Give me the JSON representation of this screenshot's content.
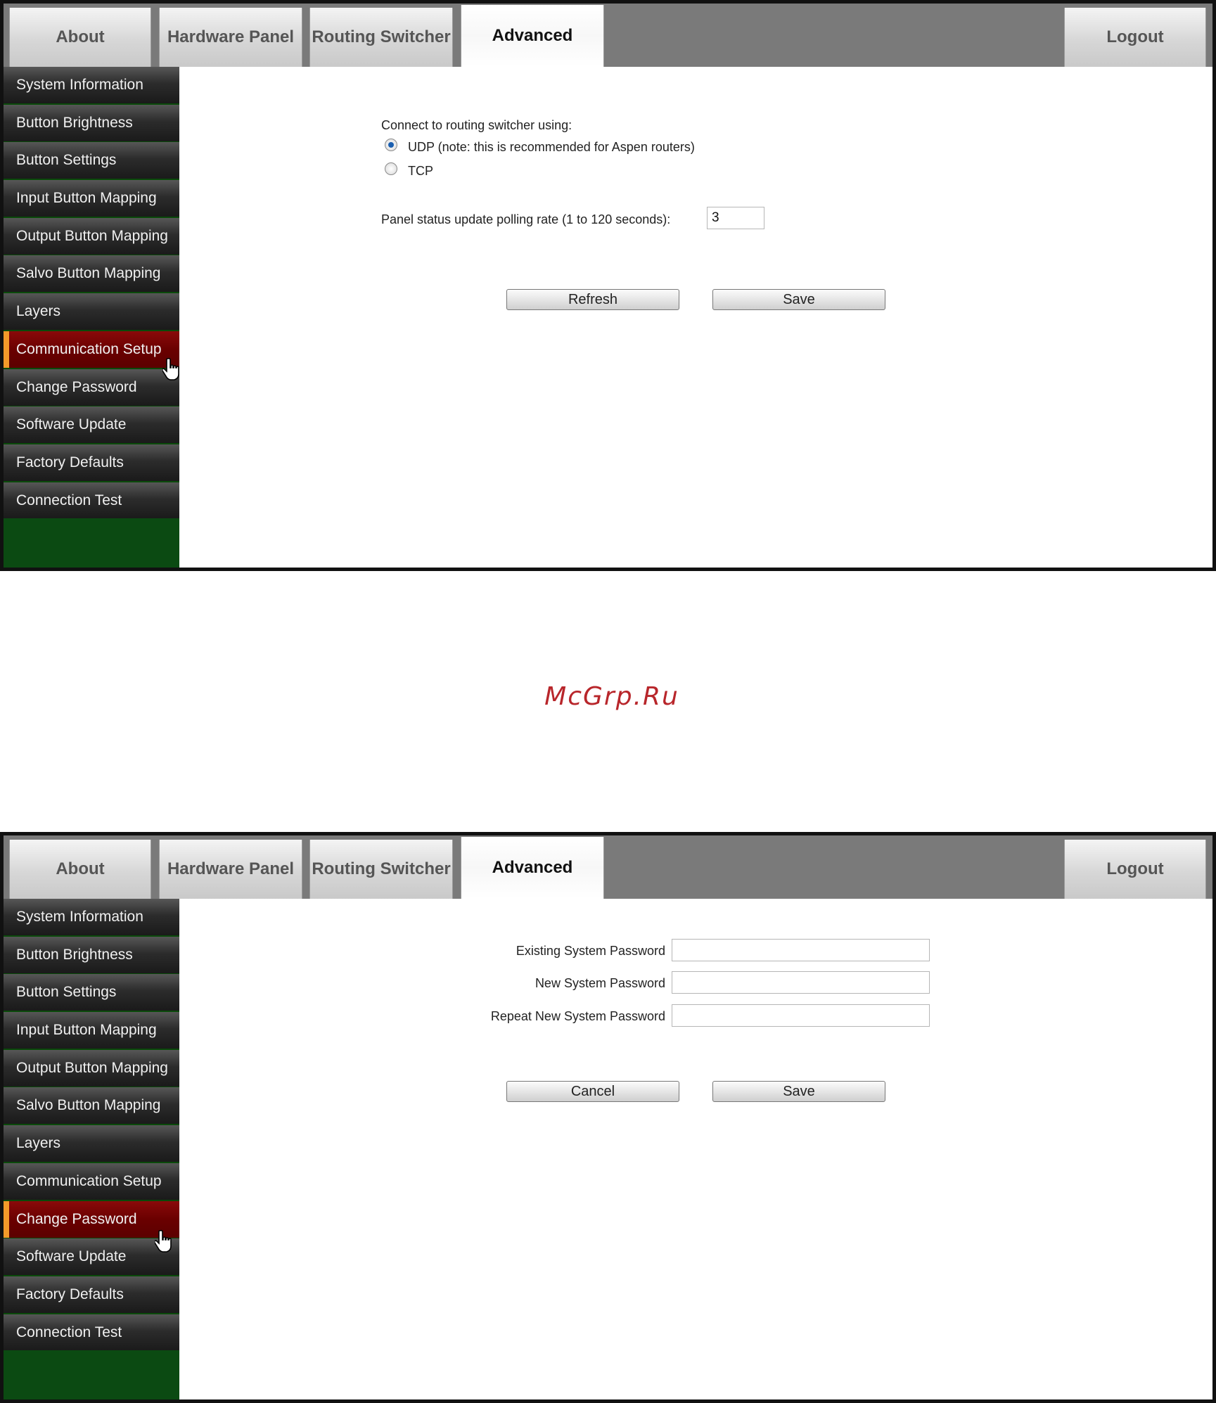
{
  "tabs": {
    "about": "About",
    "hardware_panel": "Hardware Panel",
    "routing_switcher": "Routing Switcher",
    "advanced": "Advanced",
    "logout": "Logout"
  },
  "sidebar": {
    "items": [
      "System Information",
      "Button Brightness",
      "Button Settings",
      "Input Button Mapping",
      "Output Button Mapping",
      "Salvo Button Mapping",
      "Layers",
      "Communication Setup",
      "Change Password",
      "Software Update",
      "Factory Defaults",
      "Connection Test"
    ]
  },
  "screen1": {
    "active_tab": "Advanced",
    "active_sidebar_item": "Communication Setup",
    "connect_label": "Connect to routing switcher using:",
    "udp_label": "UDP (note: this is recommended for Aspen routers)",
    "tcp_label": "TCP",
    "selected_protocol": "UDP",
    "polling_label": "Panel status update polling rate (1 to 120 seconds):",
    "polling_value": "3",
    "refresh_button": "Refresh",
    "save_button": "Save"
  },
  "screen2": {
    "active_tab": "Advanced",
    "active_sidebar_item": "Change Password",
    "existing_password_label": "Existing System Password",
    "new_password_label": "New System Password",
    "repeat_password_label": "Repeat New System Password",
    "existing_password_value": "",
    "new_password_value": "",
    "repeat_password_value": "",
    "cancel_button": "Cancel",
    "save_button": "Save"
  },
  "watermark": "McGrp.Ru",
  "colors": {
    "active_item": "#6a0000",
    "active_item_marker": "#f39a2a",
    "sidebar_footer": "#0b4a12",
    "tabbar_background": "#7a7a7a",
    "radio_selected": "#1b5fb0",
    "watermark": "#b8262b"
  }
}
